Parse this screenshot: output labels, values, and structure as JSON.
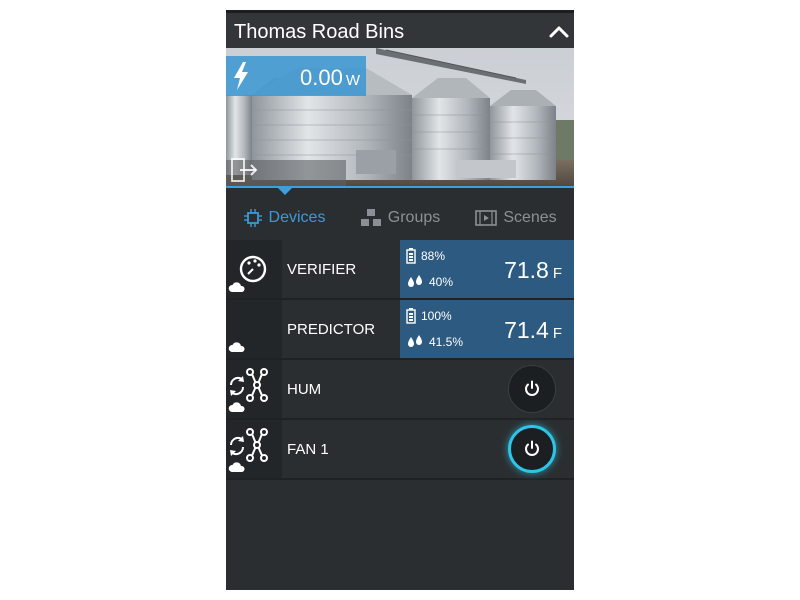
{
  "header": {
    "title": "Thomas Road Bins",
    "power_value": "0.00",
    "power_unit": "W"
  },
  "tabs": [
    {
      "label": "Devices",
      "icon": "chip-icon",
      "active": true
    },
    {
      "label": "Groups",
      "icon": "groups-icon",
      "active": false
    },
    {
      "label": "Scenes",
      "icon": "film-icon",
      "active": false
    }
  ],
  "devices": [
    {
      "name": "VERIFIER",
      "kind": "sensor",
      "battery": "88%",
      "humidity": "40%",
      "temperature": "71.8",
      "temp_unit": "F"
    },
    {
      "name": "PREDICTOR",
      "kind": "sensor",
      "battery": "100%",
      "humidity": "41.5%",
      "temperature": "71.4",
      "temp_unit": "F"
    },
    {
      "name": "HUM",
      "kind": "switch",
      "on": false
    },
    {
      "name": "FAN 1",
      "kind": "switch",
      "on": true
    }
  ],
  "colors": {
    "accent": "#3a9ad8",
    "sensor_panel": "#2c5a80",
    "power_on_ring": "#2ec4e8",
    "background": "#2b2e30"
  }
}
